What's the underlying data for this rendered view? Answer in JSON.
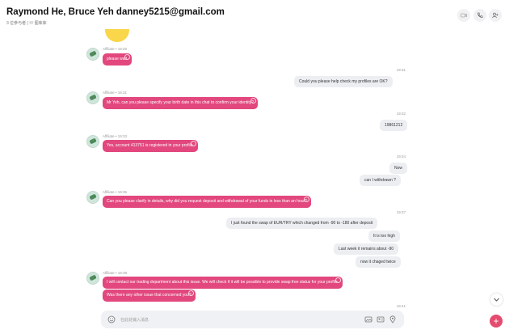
{
  "header": {
    "title": "Raymond He, Bruce Yeh danney5215@gmail.com",
    "subtitle": "3 位参与者  |  ☏ 图库库"
  },
  "messages": {
    "m1": {
      "meta": "Affiliate • 19:29",
      "text": "please wait."
    },
    "m2": {
      "time": "19:31",
      "text": "Could you please help check my profiles are OK?"
    },
    "m3": {
      "meta": "Affiliate • 19:31",
      "text": "Mr Yeh, can you please specify your birth date in this chat to confirm your identity?"
    },
    "m4": {
      "time": "19:32",
      "text": "19861212"
    },
    "m5": {
      "meta": "Affiliate • 19:33",
      "text": "Yes, account 413751 is registered in your profile."
    },
    "m6": {
      "time": "19:34",
      "text1": "Now",
      "text2": "can I withdrawn ?"
    },
    "m7": {
      "meta": "Affiliate • 19:35",
      "text": "Can you please clarify in details, why did you request deposit and withdrawal of your funds in less than an hour?"
    },
    "m8": {
      "time": "19:37",
      "text1": "I just found  the swap of EUR/TRY  which changed from -90 to -180  after deposit",
      "text2": "It is too high",
      "text3": "Last week it remains about -90",
      "text4": "now it chaged twice"
    },
    "m9": {
      "meta": "Affiliate • 19:39",
      "text1": "I will contact our trading department about this issue. We will check if it will be possible to provide swap free status for your profile.",
      "text2": "Was there any other issue that concerned you?"
    },
    "m10": {
      "time": "19:41"
    }
  },
  "composer": {
    "placeholder": "在此处输入消息"
  },
  "colors": {
    "affiliate_bubble": "#e2477d",
    "own_bubble": "#eceef2",
    "send_button": "#e54b6e"
  },
  "icons": [
    "video-call-icon",
    "phone-call-icon",
    "add-person-icon",
    "emoji-icon",
    "image-icon",
    "contact-card-icon",
    "location-icon",
    "chevron-down-icon",
    "plus-icon"
  ]
}
